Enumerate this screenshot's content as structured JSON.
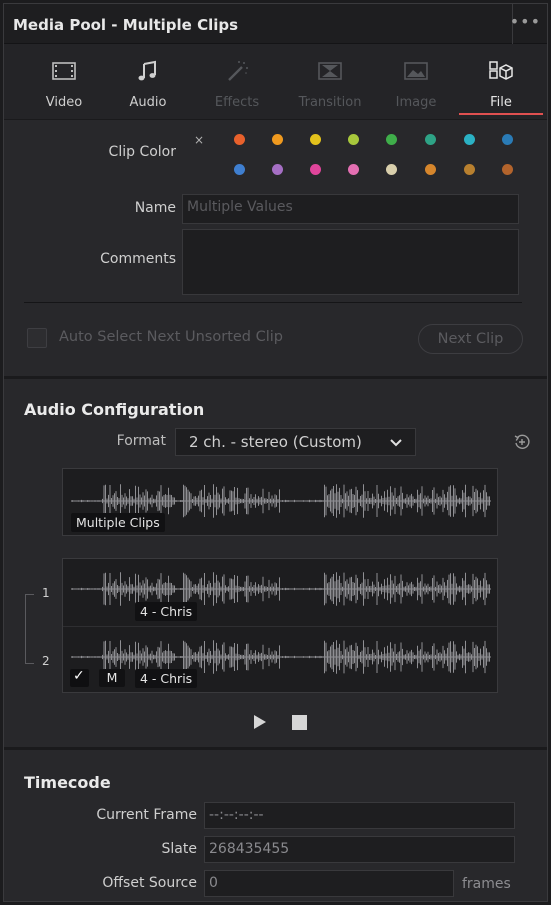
{
  "window": {
    "title": "Media Pool - Multiple Clips",
    "menu_label": "•••"
  },
  "tabs": [
    {
      "label": "Video",
      "icon": "film-icon",
      "state": "enabled"
    },
    {
      "label": "Audio",
      "icon": "music-note-icon",
      "state": "enabled"
    },
    {
      "label": "Effects",
      "icon": "magic-wand-icon",
      "state": "disabled"
    },
    {
      "label": "Transition",
      "icon": "transition-icon",
      "state": "disabled"
    },
    {
      "label": "Image",
      "icon": "image-icon",
      "state": "disabled"
    },
    {
      "label": "File",
      "icon": "file-boxes-icon",
      "state": "active"
    }
  ],
  "clip_color": {
    "label": "Clip Color",
    "clear_glyph": "×",
    "row1": [
      "#e8612c",
      "#f09a1f",
      "#e3c21c",
      "#a8c83c",
      "#3fae4a",
      "#2ea386",
      "#2bb1c4",
      "#2a7bb6"
    ],
    "row2": [
      "#3f7fd0",
      "#a56fc4",
      "#e0459b",
      "#e46fb2",
      "#d9cfac",
      "#d6862c",
      "#b8802f",
      "#b3642c"
    ]
  },
  "name_field": {
    "label": "Name",
    "placeholder": "Multiple Values"
  },
  "comments_field": {
    "label": "Comments",
    "value": ""
  },
  "auto_select": {
    "label": "Auto Select Next Unsorted Clip",
    "checked": false
  },
  "next_clip_button": {
    "label": "Next Clip"
  },
  "audio_config": {
    "title": "Audio Configuration",
    "format_label": "Format",
    "format_value": "2 ch. - stereo (Custom)",
    "preview_tag": "Multiple Clips",
    "channels": [
      {
        "number": "1",
        "tag": "4 - Chris"
      },
      {
        "number": "2",
        "tag": "4 - Chris"
      }
    ],
    "enable_checkmark": "✓",
    "mute_label": "M"
  },
  "timecode": {
    "title": "Timecode",
    "current_frame_label": "Current Frame",
    "current_frame_value": "--:--:--:--",
    "slate_label": "Slate",
    "slate_value": "268435455",
    "offset_source_label": "Offset Source",
    "offset_source_value": "0",
    "offset_unit": "frames"
  },
  "colors": {
    "accent": "#e05050",
    "panel": "#28282b",
    "field": "#1e1e20"
  }
}
